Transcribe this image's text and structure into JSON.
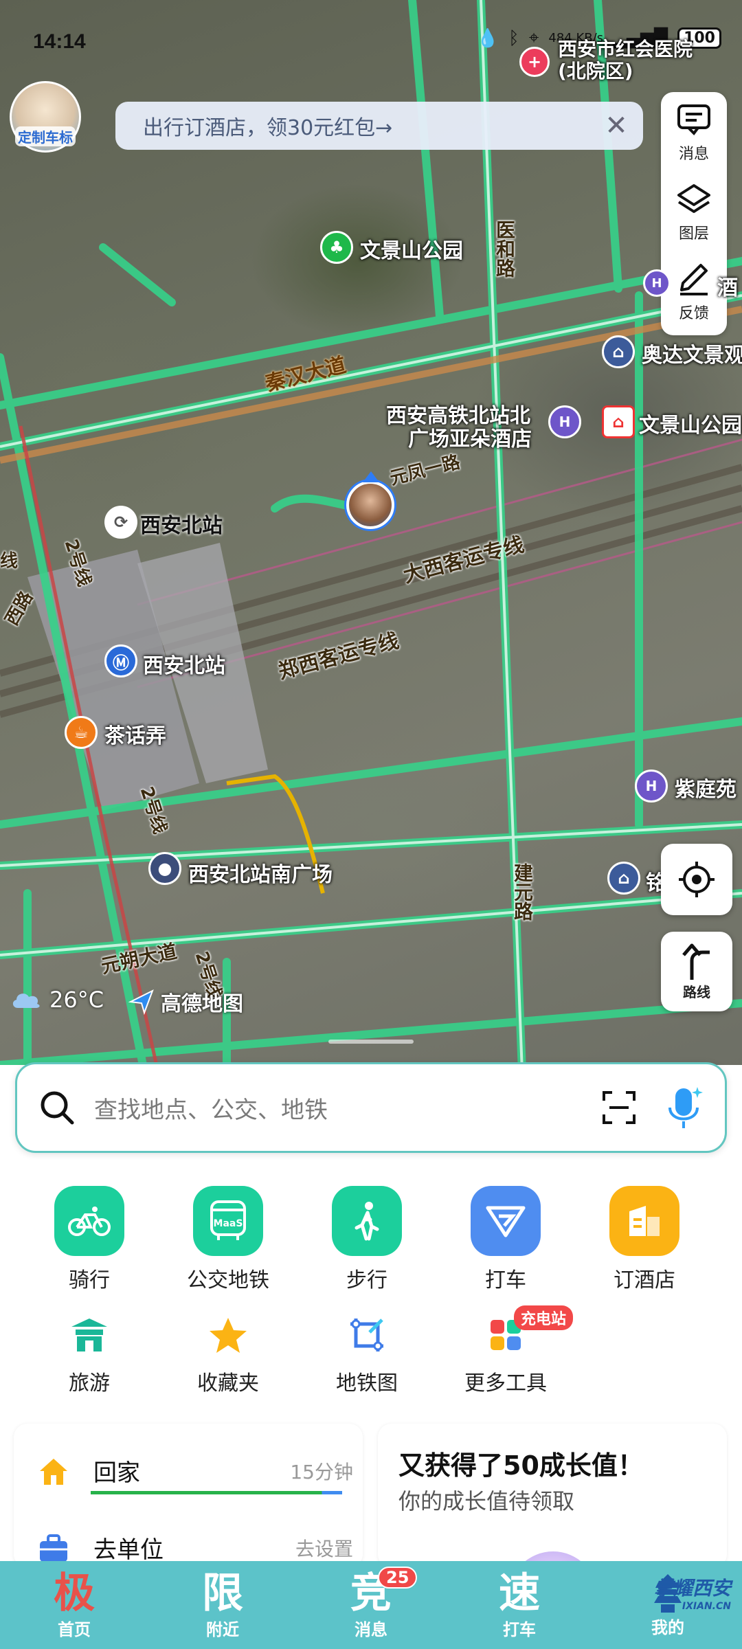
{
  "status_bar": {
    "time": "14:14",
    "net_speed": "484 KB/s",
    "battery": "100"
  },
  "header": {
    "avatar_text": "定制车标",
    "promo_text": "出行订酒店，领30元红包→",
    "promo_close": "✕"
  },
  "side_tools": [
    {
      "label": "消息",
      "icon": "message-icon"
    },
    {
      "label": "图层",
      "icon": "layers-icon"
    },
    {
      "label": "反馈",
      "icon": "feedback-pen-icon"
    }
  ],
  "map": {
    "poi_labels": {
      "hospital": "西安市红会医院(北院区)",
      "park": "文景山公园",
      "hotel": "西安高铁北站北广场亚朵酒店",
      "hotel_line2": "广场亚朵酒店",
      "hotel_line1": "西安高铁北站北",
      "park_right": "文景山公园",
      "community": "奥达文景观",
      "station_north": "西安北站",
      "station_metro": "西安北站",
      "tea": "茶话弄",
      "ziting": "紫庭苑",
      "south_square": "西安北站南广场",
      "ming": "铭",
      "jiu": "酒",
      "xi": "酒"
    },
    "road_labels": {
      "qinhan": "秦汉大道",
      "yuanfeng": "元凤一路",
      "daxi": "大西客运专线",
      "zhengxi": "郑西客运专线",
      "yuanshuo": "元朔大道",
      "jianyuan": "建元路",
      "yihe": "医和路",
      "line2_a": "2号线",
      "line2_b": "2号线",
      "line2_c": "2号线",
      "xi_road": "西路",
      "xian": "线"
    },
    "weather": {
      "temp": "26°C",
      "icon": "cloud-icon"
    },
    "brand": "高德地图",
    "route_label": "路线"
  },
  "search": {
    "placeholder": "查找地点、公交、地铁"
  },
  "quick_actions": [
    {
      "label": "骑行",
      "icon": "bike-icon",
      "color": "#1ccf9c"
    },
    {
      "label": "公交地铁",
      "icon": "bus-icon",
      "color": "#1ccf9c",
      "sub": "MaaS"
    },
    {
      "label": "步行",
      "icon": "walk-icon",
      "color": "#1ccf9c"
    },
    {
      "label": "打车",
      "icon": "taxi-icon",
      "color": "#4f8df0"
    },
    {
      "label": "订酒店",
      "icon": "hotel-icon",
      "color": "#fbb314"
    }
  ],
  "tools": [
    {
      "label": "旅游",
      "icon": "travel-icon"
    },
    {
      "label": "收藏夹",
      "icon": "star-icon"
    },
    {
      "label": "地铁图",
      "icon": "metro-map-icon"
    },
    {
      "label": "更多工具",
      "icon": "more-tools-icon",
      "badge": "充电站"
    }
  ],
  "commute": [
    {
      "label": "回家",
      "meta": "15分钟",
      "icon": "home-icon"
    },
    {
      "label": "去单位",
      "meta": "去设置",
      "icon": "briefcase-icon"
    }
  ],
  "growth_card": {
    "title": "又获得了50成长值！",
    "subtitle": "你的成长值待领取"
  },
  "tabs": [
    {
      "big": "极",
      "small": "首页",
      "active": true
    },
    {
      "big": "限",
      "small": "附近"
    },
    {
      "big": "竞",
      "small": "消息",
      "badge": "25"
    },
    {
      "big": "速",
      "small": "打车"
    },
    {
      "big": "",
      "small": "我的"
    }
  ],
  "watermark": {
    "main": "掌耀西安",
    "sub": "IXIAN.CN"
  },
  "colors": {
    "road_green": "#36d28a",
    "accent_teal": "#5cc3c9",
    "brand_red": "#e8524a"
  }
}
